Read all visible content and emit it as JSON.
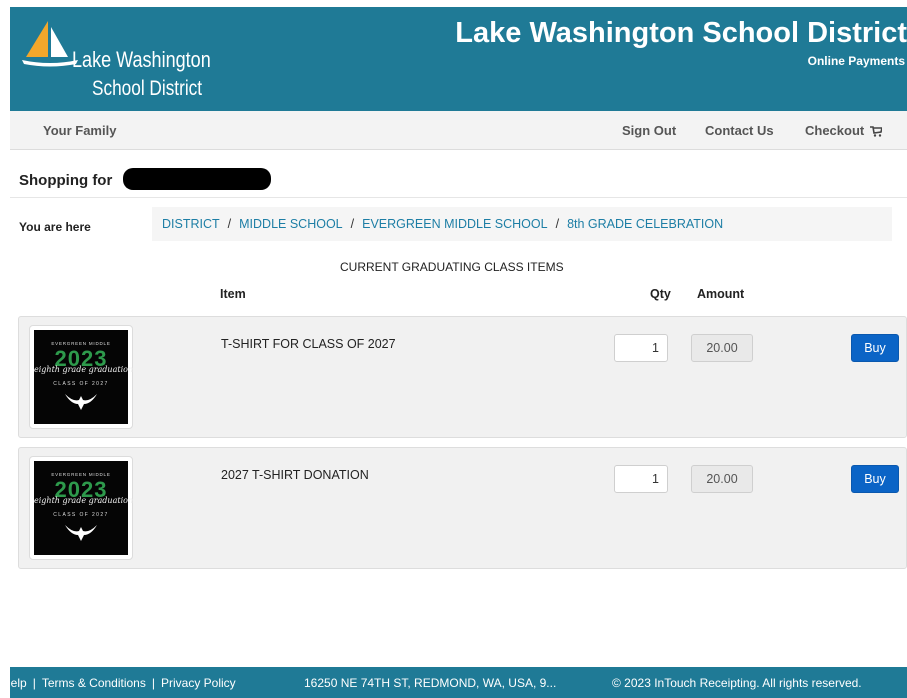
{
  "header": {
    "logo_line1": "Lake Washington",
    "logo_line2": "School District",
    "title": "Lake Washington School District",
    "subtitle": "Online Payments",
    "bg_color": "#1f7a96"
  },
  "nav": {
    "your_family": "Your Family",
    "sign_out": "Sign Out",
    "contact_us": "Contact Us",
    "checkout": "Checkout",
    "checkout_icon": "cart-icon"
  },
  "shopping": {
    "label": "Shopping for"
  },
  "breadcrumb": {
    "label": "You are here",
    "items": [
      "DISTRICT",
      "MIDDLE SCHOOL",
      "EVERGREEN MIDDLE SCHOOL",
      "8th GRADE CELEBRATION"
    ],
    "separator": "/"
  },
  "items_section": {
    "title": "CURRENT GRADUATING CLASS ITEMS",
    "col_item": "Item",
    "col_qty": "Qty",
    "col_amount": "Amount",
    "items": [
      {
        "name": "T-SHIRT FOR CLASS OF 2027",
        "qty": "1",
        "amount": "20.00",
        "buy_label": "Buy",
        "thumb": {
          "top": "EVERGREEN MIDDLE",
          "year": "2023",
          "script": "eighth grade graduation",
          "class": "CLASS OF 2027"
        }
      },
      {
        "name": "2027 T-SHIRT DONATION",
        "qty": "1",
        "amount": "20.00",
        "buy_label": "Buy",
        "thumb": {
          "top": "EVERGREEN MIDDLE",
          "year": "2023",
          "script": "eighth grade graduation",
          "class": "CLASS OF 2027"
        }
      }
    ]
  },
  "footer": {
    "help": "Help",
    "terms": "Terms & Conditions",
    "privacy": "Privacy Policy",
    "separator": "|",
    "address": "16250 NE 74TH ST, REDMOND, WA, USA, 9...",
    "copyright": "© 2023 InTouch Receipting. All rights reserved."
  },
  "colors": {
    "accent": "#1f7a96",
    "link": "#1d7ea5",
    "buy_button": "#0b64c6",
    "thumb_year": "#2e9a4c"
  }
}
